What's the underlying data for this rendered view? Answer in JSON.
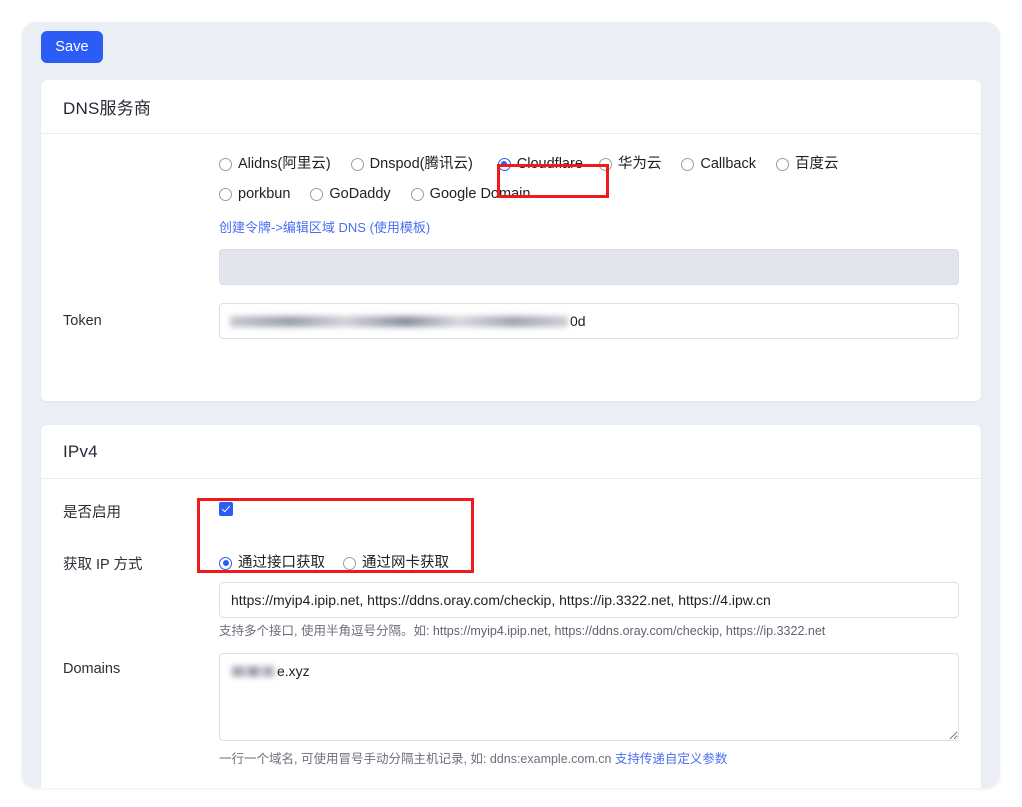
{
  "toolbar": {
    "save_label": "Save"
  },
  "colors": {
    "accent": "#2b5cf6",
    "annotation": "#ef1b1b",
    "panel_bg": "#eceef6",
    "card_bg": "#ffffff",
    "link": "#4a6ef0"
  },
  "dns_section": {
    "title": "DNS服务商",
    "provider_label": "",
    "providers_row1": [
      {
        "label": "Alidns(阿里云)",
        "checked": false
      },
      {
        "label": "Dnspod(腾讯云)",
        "checked": false
      },
      {
        "label": "Cloudflare",
        "checked": true
      },
      {
        "label": "华为云",
        "checked": false
      },
      {
        "label": "Callback",
        "checked": false
      },
      {
        "label": "百度云",
        "checked": false
      }
    ],
    "providers_row2": [
      {
        "label": "porkbun",
        "checked": false
      },
      {
        "label": "GoDaddy",
        "checked": false
      },
      {
        "label": "Google Domain",
        "checked": false
      }
    ],
    "helper_link": "创建令牌->编辑区域 DNS (使用模板)",
    "disabled_field": {
      "value": "",
      "placeholder": ""
    },
    "token": {
      "label": "Token",
      "value_visible_tail": "0d",
      "masked": true
    }
  },
  "ipv4_section": {
    "title": "IPv4",
    "enable": {
      "label": "是否启用",
      "checked": true
    },
    "ip_method": {
      "label": "获取 IP 方式",
      "options": [
        {
          "label": "通过接口获取",
          "checked": true
        },
        {
          "label": "通过网卡获取",
          "checked": false
        }
      ]
    },
    "url_field": {
      "value": "https://myip4.ipip.net, https://ddns.oray.com/checkip, https://ip.3322.net, https://4.ipw.cn",
      "hint_prefix": "支持多个接口, 使用半角逗号分隔。如: ",
      "hint_example": "https://myip4.ipip.net, https://ddns.oray.com/checkip, https://ip.3322.net"
    },
    "domains": {
      "label": "Domains",
      "value_visible_tail": "e.xyz",
      "masked": true,
      "hint_prefix": "一行一个域名, 可使用冒号手动分隔主机记录, 如: ddns:example.com.cn ",
      "hint_link": "支持传递自定义参数"
    }
  },
  "annotations": [
    {
      "name": "cloudflare-highlight"
    },
    {
      "name": "ipv4-enable-method-highlight"
    }
  ]
}
